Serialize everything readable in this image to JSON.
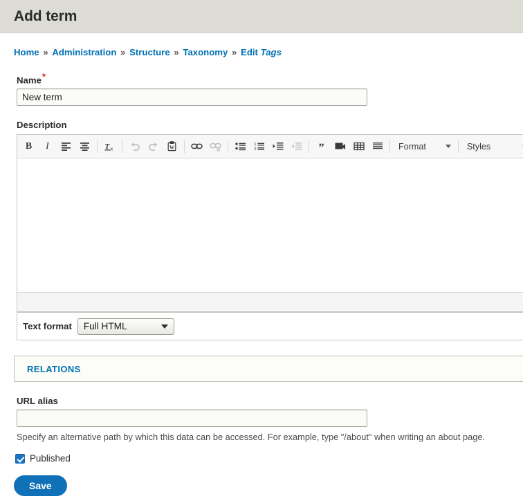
{
  "header": {
    "title": "Add term"
  },
  "breadcrumb": {
    "separator": "»",
    "items": [
      {
        "label": "Home",
        "link": true
      },
      {
        "label": "Administration",
        "link": true
      },
      {
        "label": "Structure",
        "link": true
      },
      {
        "label": "Taxonomy",
        "link": true
      },
      {
        "label": "Edit",
        "link": true,
        "italic_suffix": "Tags"
      }
    ]
  },
  "form": {
    "name_field": {
      "label": "Name",
      "required_mark": "*",
      "value": "New term",
      "placeholder": ""
    },
    "description_field": {
      "label": "Description"
    },
    "editor": {
      "buttons": [
        {
          "name": "bold-icon",
          "label": "B",
          "enabled": true
        },
        {
          "name": "italic-icon",
          "label": "I",
          "enabled": true
        },
        {
          "name": "align-left-icon",
          "label": "Align left",
          "enabled": true
        },
        {
          "name": "align-center-icon",
          "label": "Align center",
          "enabled": true
        },
        {
          "name": "remove-format-icon",
          "label": "Remove format",
          "enabled": true
        },
        {
          "name": "undo-icon",
          "label": "Undo",
          "enabled": false
        },
        {
          "name": "redo-icon",
          "label": "Redo",
          "enabled": false
        },
        {
          "name": "paste-from-word-icon",
          "label": "Paste from Word",
          "enabled": true
        },
        {
          "name": "link-icon",
          "label": "Link",
          "enabled": true
        },
        {
          "name": "unlink-icon",
          "label": "Unlink",
          "enabled": false
        },
        {
          "name": "bulleted-list-icon",
          "label": "Bulleted list",
          "enabled": true
        },
        {
          "name": "numbered-list-icon",
          "label": "Numbered list",
          "enabled": true
        },
        {
          "name": "indent-icon",
          "label": "Increase indent",
          "enabled": true
        },
        {
          "name": "outdent-icon",
          "label": "Decrease indent",
          "enabled": false
        },
        {
          "name": "blockquote-icon",
          "label": "Block quote",
          "enabled": true
        },
        {
          "name": "image-icon",
          "label": "Image",
          "enabled": true
        },
        {
          "name": "table-icon",
          "label": "Table",
          "enabled": true
        },
        {
          "name": "horizontal-rule-icon",
          "label": "Horizontal line",
          "enabled": true
        }
      ],
      "format_dropdown": "Format",
      "styles_dropdown": "Styles",
      "content": ""
    },
    "text_format": {
      "label": "Text format",
      "selected": "Full HTML"
    },
    "relations": {
      "legend": "RELATIONS"
    },
    "url_alias": {
      "label": "URL alias",
      "value": "",
      "placeholder": "",
      "help": "Specify an alternative path by which this data can be accessed. For example, type \"/about\" when writing an about page."
    },
    "published": {
      "label": "Published",
      "checked": true
    },
    "save_button": "Save"
  },
  "colors": {
    "header_bg": "#dcdcd4",
    "link": "#0071b3",
    "accent_blue": "#1070b8",
    "required_red": "#e02424",
    "fieldset_bg": "#fcfcf8"
  }
}
